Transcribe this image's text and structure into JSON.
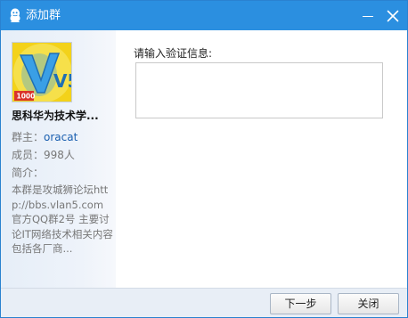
{
  "window": {
    "title": "添加群",
    "minimize_icon": "minimize-icon",
    "close_icon": "close-icon"
  },
  "group": {
    "avatar_text": "V5",
    "avatar_badge": "1000",
    "name": "思科华为技术学...",
    "owner_label": "群主：",
    "owner_value": "oracat",
    "members_text": "成员：998人",
    "intro_label": "简介：",
    "intro_text": "本群是攻城狮论坛http://bbs.vlan5.com 官方QQ群2号 主要讨论IT网络技术相关内容 包括各厂商..."
  },
  "form": {
    "prompt": "请输入验证信息:",
    "message_value": ""
  },
  "footer": {
    "next_label": "下一步",
    "close_label": "关闭"
  },
  "colors": {
    "titlebar": "#2b8fe0",
    "link": "#1a5fb0",
    "sidebar": "#e6eef8"
  }
}
